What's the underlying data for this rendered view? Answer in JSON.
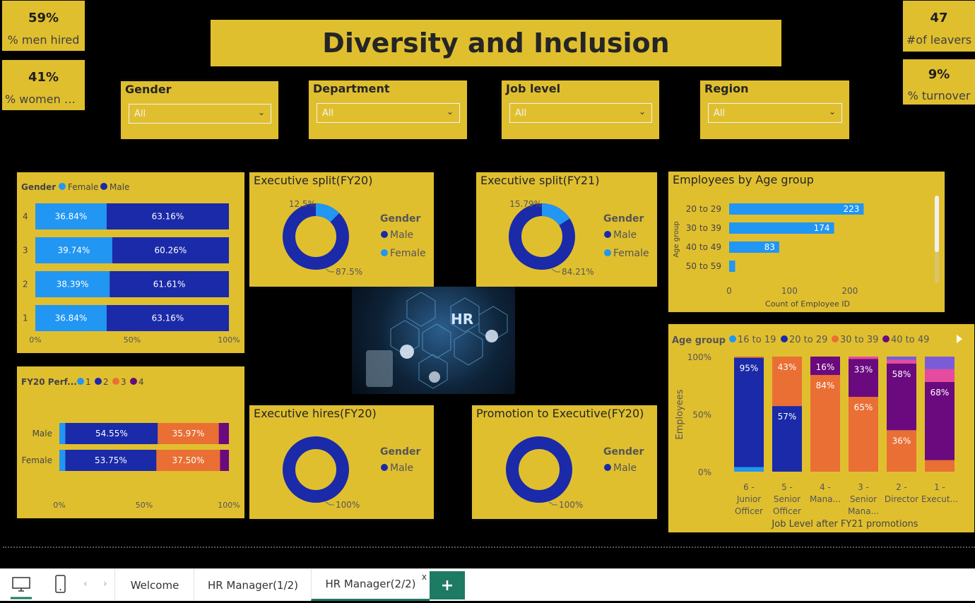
{
  "title": "Diversity and Inclusion",
  "kpis": {
    "men_hired": {
      "value": "59%",
      "label": "% men hired"
    },
    "women_hired": {
      "value": "41%",
      "label": "% women hi..."
    },
    "leavers": {
      "value": "47",
      "label": "#of leavers"
    },
    "turnover": {
      "value": "9%",
      "label": "% turnover"
    }
  },
  "slicers": [
    {
      "label": "Gender",
      "value": "All"
    },
    {
      "label": "Department",
      "value": "All"
    },
    {
      "label": "Job level",
      "value": "All"
    },
    {
      "label": "Region",
      "value": "All"
    }
  ],
  "colors": {
    "card": "#e0bf2f",
    "female": "#2196f3",
    "male": "#1a2aa8",
    "orange": "#ea6f34",
    "purple": "#6a0a7e",
    "pink": "#e54b9e",
    "lavender": "#7c5cd6"
  },
  "gender_chart": {
    "legend_title": "Gender",
    "legend": [
      "Female",
      "Male"
    ],
    "categories": [
      "4",
      "3",
      "2",
      "1"
    ],
    "female": [
      36.84,
      39.74,
      38.39,
      36.84
    ],
    "male": [
      63.16,
      60.26,
      61.61,
      63.16
    ],
    "female_labels": [
      "36.84%",
      "39.74%",
      "38.39%",
      "36.84%"
    ],
    "male_labels": [
      "63.16%",
      "60.26%",
      "61.61%",
      "63.16%"
    ],
    "x_ticks": [
      "0%",
      "50%",
      "100%"
    ]
  },
  "perf_chart": {
    "legend_title": "FY20 Perf...",
    "legend": [
      "1",
      "2",
      "3",
      "4"
    ],
    "categories": [
      "Male",
      "Female"
    ],
    "segments": [
      [
        3.5,
        54.55,
        35.97,
        5.98
      ],
      [
        3.5,
        53.75,
        37.5,
        5.25
      ]
    ],
    "labels": [
      [
        "",
        "54.55%",
        "35.97%",
        ""
      ],
      [
        "",
        "53.75%",
        "37.50%",
        ""
      ]
    ],
    "x_ticks": [
      "0%",
      "50%",
      "100%"
    ]
  },
  "exec_fy20": {
    "title": "Executive split(FY20)",
    "legend_title": "Gender",
    "legend": [
      "Male",
      "Female"
    ],
    "male": 87.5,
    "female": 12.5,
    "male_label": "87.5%",
    "female_label": "12.5%"
  },
  "exec_fy21": {
    "title": "Executive split(FY21)",
    "legend_title": "Gender",
    "legend": [
      "Male",
      "Female"
    ],
    "male": 84.21,
    "female": 15.79,
    "male_label": "84.21%",
    "female_label": "15.79%"
  },
  "exec_hires": {
    "title": "Executive hires(FY20)",
    "legend_title": "Gender",
    "legend": [
      "Male"
    ],
    "male": 100,
    "male_label": "100%"
  },
  "promo_exec": {
    "title": "Promotion to Executive(FY20)",
    "legend_title": "Gender",
    "legend": [
      "Male"
    ],
    "male": 100,
    "male_label": "100%"
  },
  "image": {
    "text": "HR"
  },
  "age_chart": {
    "title": "Employees by Age group",
    "ylabel": "Age group",
    "xlabel": "Count of Employee ID",
    "categories": [
      "20 to 29",
      "30 to 39",
      "40 to 49",
      "50 to 59"
    ],
    "values": [
      223,
      174,
      83,
      10
    ],
    "labels": [
      "223",
      "174",
      "83",
      ""
    ],
    "x_ticks": [
      "0",
      "100",
      "200"
    ],
    "xlim": [
      0,
      260
    ]
  },
  "stack_chart": {
    "legend_title": "Age group",
    "legend": [
      "16 to 19",
      "20 to 29",
      "30 to 39",
      "40 to 49"
    ],
    "ylabel": "Employees",
    "xlabel": "Job Level after FY21 promotions",
    "y_ticks": [
      "100%",
      "50%",
      "0%"
    ],
    "categories": [
      [
        "6 -",
        "Junior",
        "Officer"
      ],
      [
        "5 -",
        "Senior",
        "Officer"
      ],
      [
        "4 -",
        "Mana..."
      ],
      [
        "3 -",
        "Senior",
        "Mana..."
      ],
      [
        "2 -",
        "Director"
      ],
      [
        "1 -",
        "Execut..."
      ]
    ],
    "segments": [
      [
        {
          "c": "female",
          "v": 4
        },
        {
          "c": "male",
          "v": 95,
          "l": "95%"
        },
        {
          "c": "orange",
          "v": 1
        }
      ],
      [
        {
          "c": "male",
          "v": 57,
          "l": "57%"
        },
        {
          "c": "orange",
          "v": 43,
          "l": "43%"
        }
      ],
      [
        {
          "c": "orange",
          "v": 84,
          "l": "84%"
        },
        {
          "c": "purple",
          "v": 16,
          "l": "16%"
        }
      ],
      [
        {
          "c": "orange",
          "v": 65,
          "l": "65%"
        },
        {
          "c": "purple",
          "v": 33,
          "l": "33%"
        },
        {
          "c": "pink",
          "v": 2
        }
      ],
      [
        {
          "c": "orange",
          "v": 36,
          "l": "36%"
        },
        {
          "c": "purple",
          "v": 58,
          "l": "58%"
        },
        {
          "c": "pink",
          "v": 3
        },
        {
          "c": "lavender",
          "v": 3
        }
      ],
      [
        {
          "c": "orange",
          "v": 10
        },
        {
          "c": "purple",
          "v": 68,
          "l": "68%"
        },
        {
          "c": "pink",
          "v": 11
        },
        {
          "c": "lavender",
          "v": 11
        }
      ]
    ]
  },
  "tabs": [
    "Welcome",
    "HR Manager(1/2)",
    "HR Manager(2/2)"
  ],
  "tab_close": "x",
  "tab_add": "+"
}
